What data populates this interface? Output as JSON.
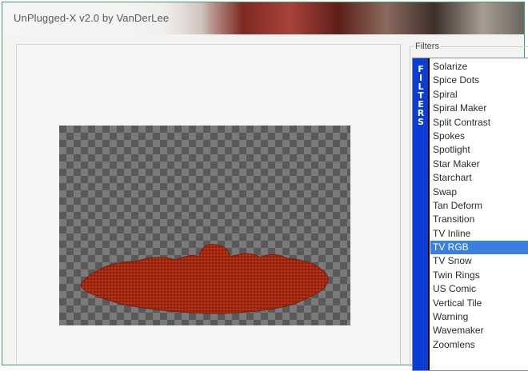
{
  "window": {
    "title": "UnPlugged-X v2.0 by VanDerLee"
  },
  "filters": {
    "group_label": "Filters",
    "strip_letters": [
      "F",
      "I",
      "L",
      "T",
      "E",
      "R",
      "S"
    ],
    "items": [
      "Solarize",
      "Spice Dots",
      "Spiral",
      "Spiral Maker",
      "Split Contrast",
      "Spokes",
      "Spotlight",
      "Star Maker",
      "Starchart",
      "Swap",
      "Tan Deform",
      "Transition",
      "TV Inline",
      "TV RGB",
      "TV Snow",
      "Twin Rings",
      "US Comic",
      "Vertical Tile",
      "Warning",
      "Wavemaker",
      "Zoomlens"
    ],
    "selected": "TV RGB"
  },
  "colors": {
    "accent_selection": "#3a7fe0",
    "filters_strip": "#0a3cd6",
    "preview_shape": "#a8290f"
  }
}
